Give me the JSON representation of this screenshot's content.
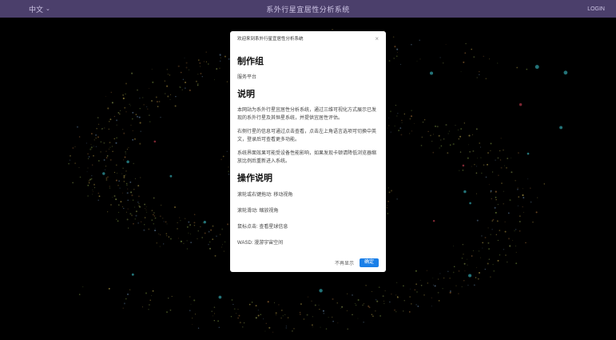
{
  "topbar": {
    "lang_label": "中文",
    "title": "系外行星宜居性分析系统",
    "login_label": "LOGIN"
  },
  "modal": {
    "title": "欢迎来到系外行星宜居性分析系统",
    "sections": {
      "team_heading": "制作组",
      "team_text": "服务平台",
      "desc_heading": "说明",
      "desc_p1": "本网站为系外行星宜居性分析系统，通过三维可视化方式展示已发现的系外行星及其恒星系统，并提供宜居性评估。",
      "desc_p2": "右侧行星的信息可通过点击查看，点击左上角语言选项可切换中英文，登录后可查看更多功能。",
      "desc_p3": "系统界面效果可能受设备性能影响，如果发现卡顿请降低浏览器缩放比例后重新进入系统。",
      "ops_heading": "操作说明",
      "op1": "滚轮或右键拖动: 移动视角",
      "op2": "滚轮滑动: 缩放视角",
      "op3": "鼠标点击: 查看星球信息",
      "op4": "WASD: 漫游宇宙空间"
    },
    "skip_label": "不再显示",
    "ok_label": "确定"
  },
  "colors": {
    "topbar_bg": "#4b3f6b",
    "primary": "#1a7fe8",
    "background": "#000000"
  },
  "icons": {
    "close": "close-icon",
    "lang_chevron": "chevron-down-icon"
  }
}
